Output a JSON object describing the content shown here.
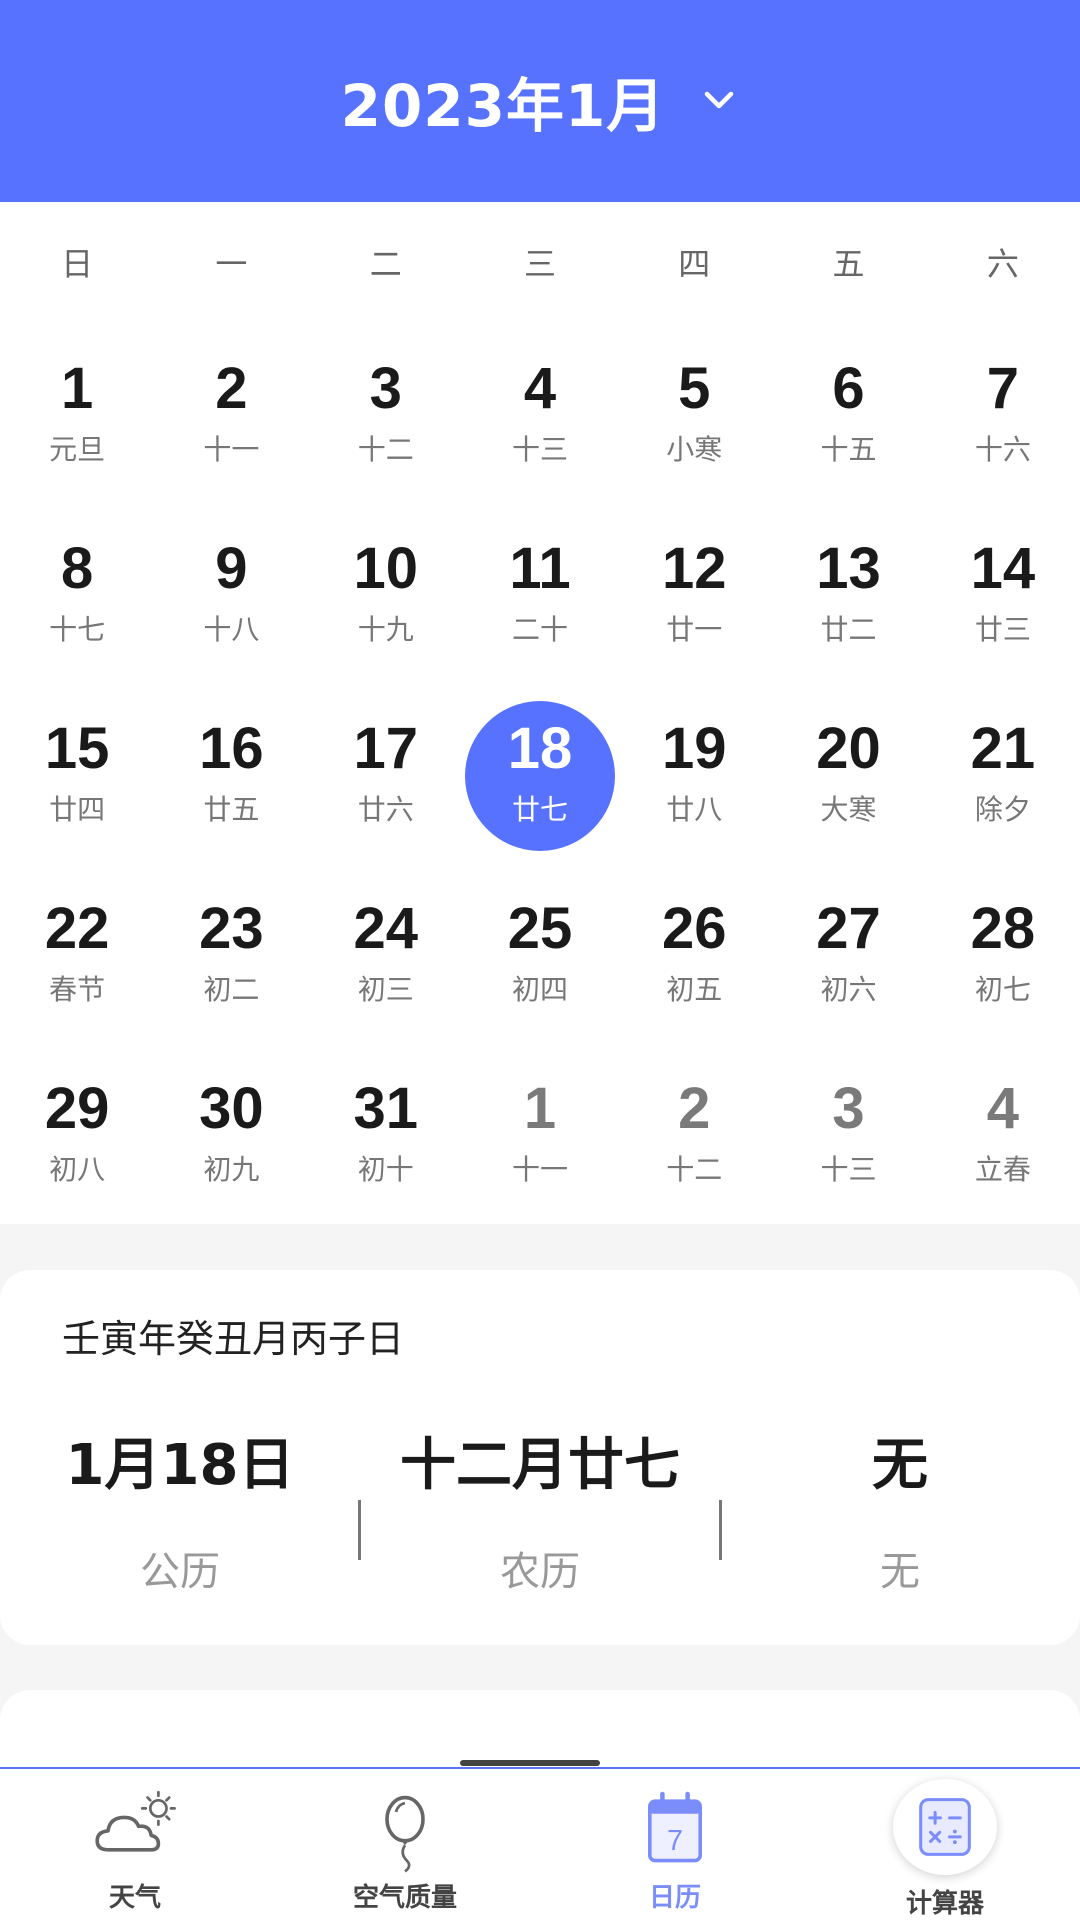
{
  "header": {
    "title": "2023年1月"
  },
  "weekdays": [
    "日",
    "一",
    "二",
    "三",
    "四",
    "五",
    "六"
  ],
  "days": [
    {
      "n": "1",
      "l": "元旦"
    },
    {
      "n": "2",
      "l": "十一"
    },
    {
      "n": "3",
      "l": "十二"
    },
    {
      "n": "4",
      "l": "十三"
    },
    {
      "n": "5",
      "l": "小寒"
    },
    {
      "n": "6",
      "l": "十五"
    },
    {
      "n": "7",
      "l": "十六"
    },
    {
      "n": "8",
      "l": "十七"
    },
    {
      "n": "9",
      "l": "十八"
    },
    {
      "n": "10",
      "l": "十九"
    },
    {
      "n": "11",
      "l": "二十"
    },
    {
      "n": "12",
      "l": "廿一"
    },
    {
      "n": "13",
      "l": "廿二"
    },
    {
      "n": "14",
      "l": "廿三"
    },
    {
      "n": "15",
      "l": "廿四"
    },
    {
      "n": "16",
      "l": "廿五"
    },
    {
      "n": "17",
      "l": "廿六"
    },
    {
      "n": "18",
      "l": "廿七",
      "selected": true
    },
    {
      "n": "19",
      "l": "廿八"
    },
    {
      "n": "20",
      "l": "大寒"
    },
    {
      "n": "21",
      "l": "除夕"
    },
    {
      "n": "22",
      "l": "春节"
    },
    {
      "n": "23",
      "l": "初二"
    },
    {
      "n": "24",
      "l": "初三"
    },
    {
      "n": "25",
      "l": "初四"
    },
    {
      "n": "26",
      "l": "初五"
    },
    {
      "n": "27",
      "l": "初六"
    },
    {
      "n": "28",
      "l": "初七"
    },
    {
      "n": "29",
      "l": "初八"
    },
    {
      "n": "30",
      "l": "初九"
    },
    {
      "n": "31",
      "l": "初十"
    },
    {
      "n": "1",
      "l": "十一",
      "other": true
    },
    {
      "n": "2",
      "l": "十二",
      "other": true
    },
    {
      "n": "3",
      "l": "十三",
      "other": true
    },
    {
      "n": "4",
      "l": "立春",
      "other": true
    }
  ],
  "info": {
    "ganzhi": "壬寅年癸丑月丙子日",
    "solar_value": "1月18日",
    "solar_label": "公历",
    "lunar_value": "十二月廿七",
    "lunar_label": "农历",
    "festival_value": "无",
    "festival_label": "无"
  },
  "nav": {
    "weather": "天气",
    "air": "空气质量",
    "calendar": "日历",
    "calendar_icon_day": "7",
    "calculator": "计算器"
  },
  "colors": {
    "accent": "#5672fe",
    "nav_active": "#7b8cfb"
  }
}
